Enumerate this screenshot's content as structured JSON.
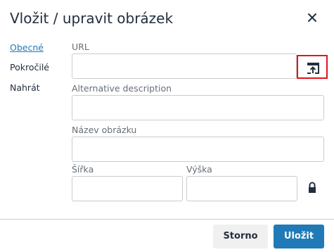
{
  "dialog": {
    "title": "Vložit / upravit obrázek",
    "close_icon": "close-icon"
  },
  "tabs": [
    {
      "label": "Obecné",
      "active": true
    },
    {
      "label": "Pokročilé",
      "active": false
    },
    {
      "label": "Nahrát",
      "active": false
    }
  ],
  "form": {
    "url_label": "URL",
    "url_value": "",
    "browse_icon": "browse-upload-icon",
    "alt_label": "Alternative description",
    "alt_value": "",
    "title_label": "Název obrázku",
    "title_value": "",
    "width_label": "Šířka",
    "width_value": "",
    "height_label": "Výška",
    "height_value": "",
    "lock_icon": "lock-icon"
  },
  "footer": {
    "cancel_label": "Storno",
    "save_label": "Uložit"
  },
  "colors": {
    "accent": "#207ab7",
    "highlight_box": "#e3141e",
    "text": "#222f3e",
    "border": "#cccccc",
    "cancel_bg": "#f0f0f0"
  }
}
